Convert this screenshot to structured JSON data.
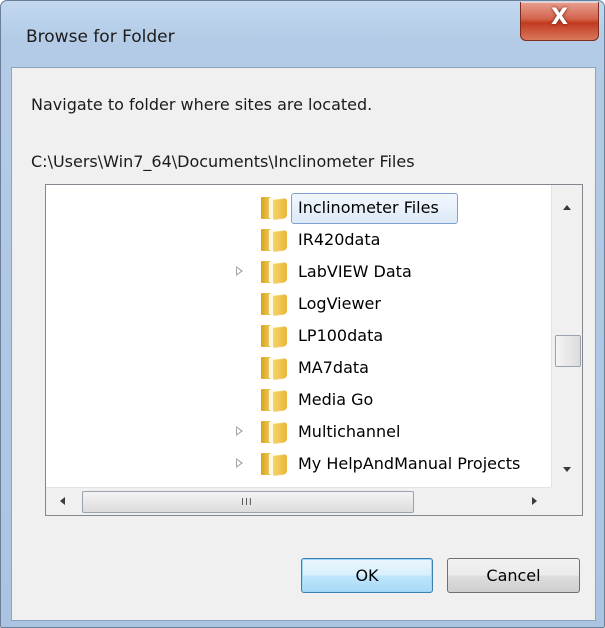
{
  "window": {
    "title": "Browse for Folder",
    "close_label": "X"
  },
  "dialog": {
    "instruction": "Navigate to folder where sites are located.",
    "current_path": "C:\\Users\\Win7_64\\Documents\\Inclinometer Files"
  },
  "tree": {
    "items": [
      {
        "label": "Inclinometer Files",
        "expandable": false,
        "selected": true,
        "icon": "folder-icon"
      },
      {
        "label": "IR420data",
        "expandable": false,
        "selected": false,
        "icon": "folder-icon"
      },
      {
        "label": "LabVIEW Data",
        "expandable": true,
        "selected": false,
        "icon": "folder-icon"
      },
      {
        "label": "LogViewer",
        "expandable": false,
        "selected": false,
        "icon": "folder-icon"
      },
      {
        "label": "LP100data",
        "expandable": false,
        "selected": false,
        "icon": "folder-icon"
      },
      {
        "label": "MA7data",
        "expandable": false,
        "selected": false,
        "icon": "folder-icon"
      },
      {
        "label": "Media Go",
        "expandable": false,
        "selected": false,
        "icon": "folder-icon"
      },
      {
        "label": "Multichannel",
        "expandable": true,
        "selected": false,
        "icon": "folder-icon"
      },
      {
        "label": "My HelpAndManual Projects",
        "expandable": true,
        "selected": false,
        "icon": "folder-icon"
      }
    ],
    "hscroll_grip": "III"
  },
  "buttons": {
    "ok_label": "OK",
    "cancel_label": "Cancel"
  },
  "colors": {
    "selection_border": "#7da2ce",
    "close_button": "#c23a20",
    "frame": "#aac4e2"
  }
}
